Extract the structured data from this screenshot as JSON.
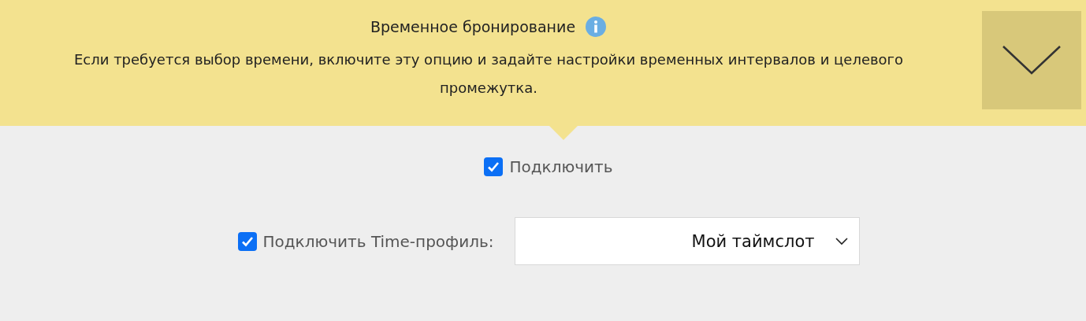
{
  "banner": {
    "title": "Временное бронирование",
    "description": "Если требуется выбор времени, включите эту опцию и задайте настройки временных интервалов и целевого промежутка.",
    "expanded": false
  },
  "enable": {
    "label": "Подключить",
    "checked": true
  },
  "time_profile": {
    "label": "Подключить Time-профиль:",
    "checked": true,
    "value": "Мой таймслот"
  }
}
